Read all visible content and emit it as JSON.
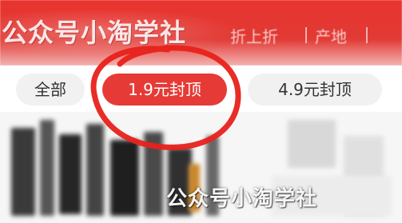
{
  "header": {
    "watermark": "公众号小淘学社",
    "links": [
      "折上折",
      "产地"
    ]
  },
  "filters": {
    "chips": [
      {
        "label": "全部"
      },
      {
        "label": "1.9元封顶"
      },
      {
        "label": "4.9元封顶"
      }
    ],
    "selected_index": 1
  },
  "content": {
    "watermark": "公众号小淘学社"
  },
  "colors": {
    "brand_red": "#e63a36",
    "chip_bg": "#f1f1f1",
    "annotation_red": "#e8211b"
  }
}
